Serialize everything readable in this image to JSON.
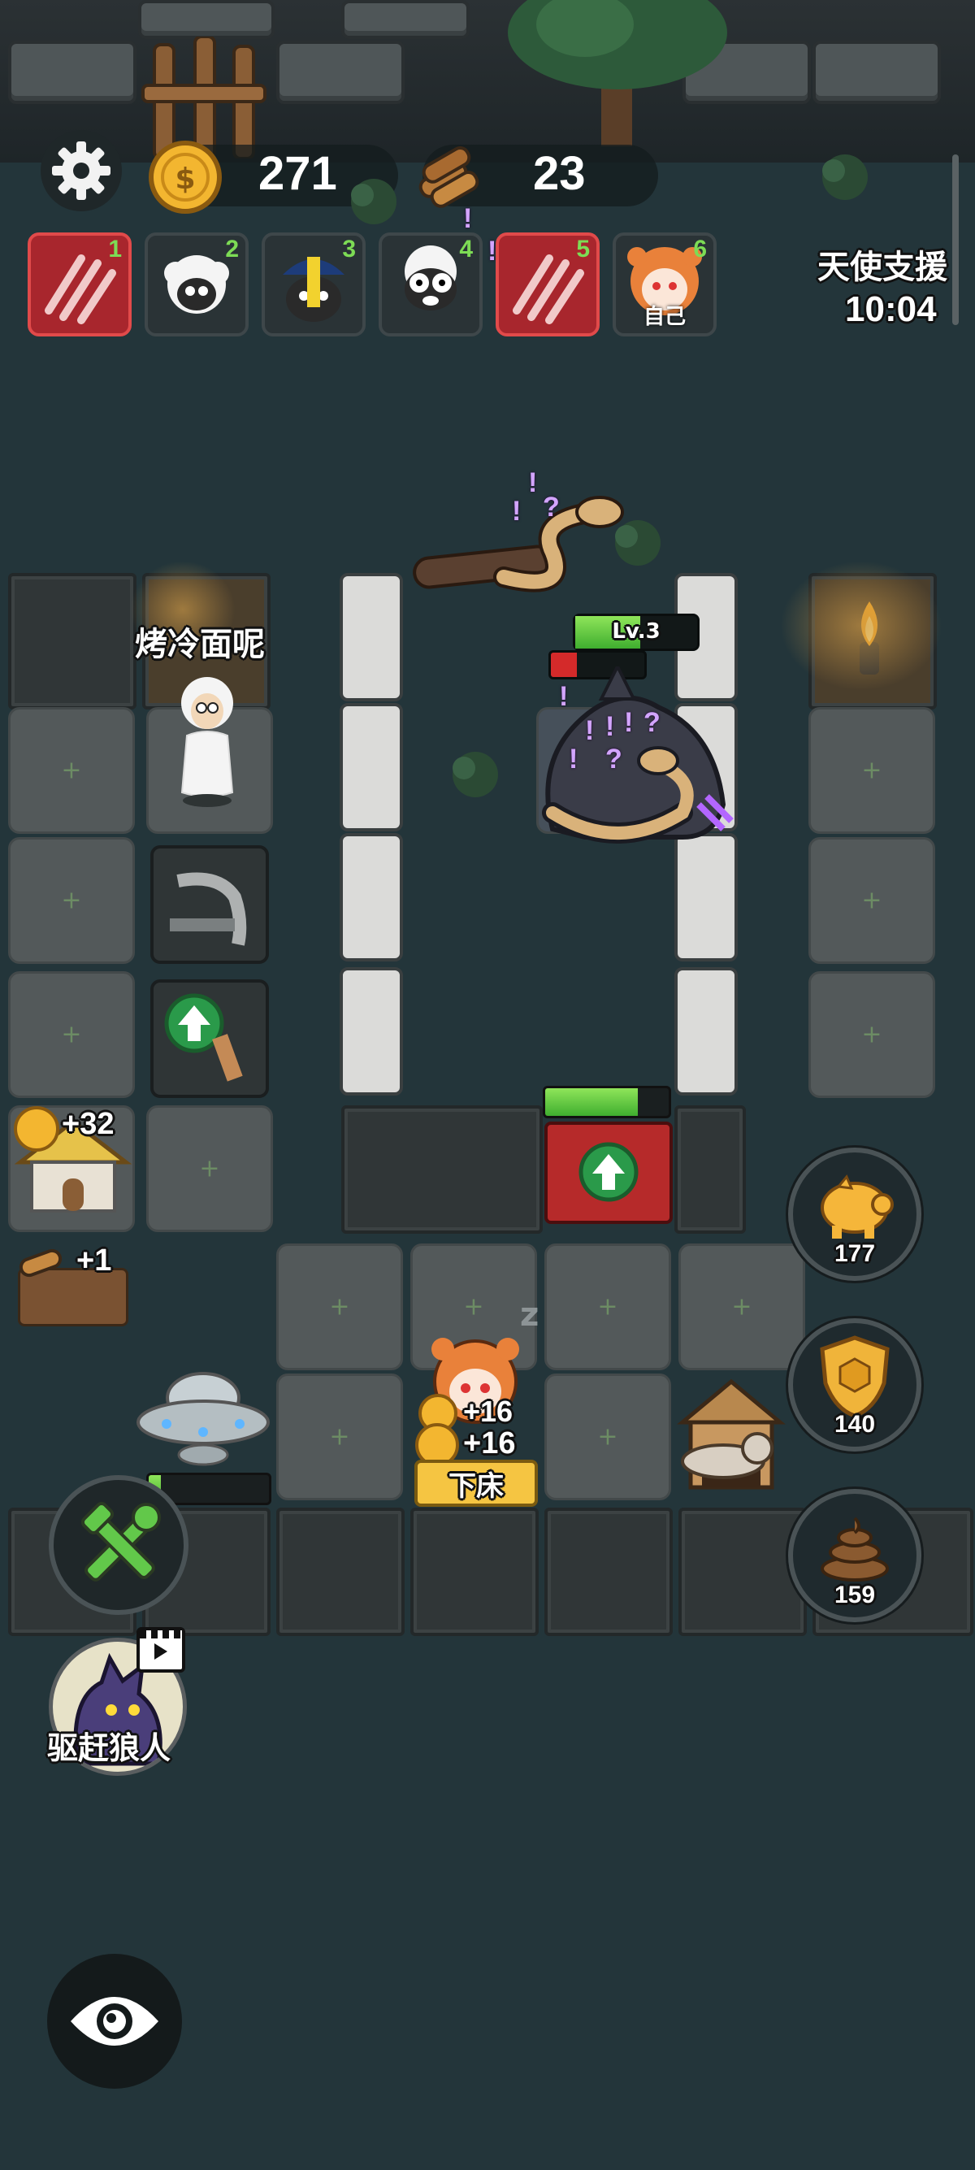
{
  "hud": {
    "coins": "271",
    "wood": "23",
    "event_title": "天使支援",
    "event_timer": "10:04"
  },
  "team": [
    {
      "num": "1",
      "type": "claw",
      "label": ""
    },
    {
      "num": "2",
      "type": "sheep",
      "label": ""
    },
    {
      "num": "3",
      "type": "sheep-hat",
      "label": ""
    },
    {
      "num": "4",
      "type": "sheep-shocked",
      "label": ""
    },
    {
      "num": "5",
      "type": "claw",
      "label": ""
    },
    {
      "num": "6",
      "type": "tiger-sheep",
      "label": "自己"
    }
  ],
  "player": {
    "name": "烤冷面呢"
  },
  "enemy": {
    "level": "Lv.3",
    "health_fraction": 0.28
  },
  "door": {
    "health_fraction": 0.75
  },
  "buildings": {
    "hut_income": "+32",
    "woodpile_income": "+1",
    "ufo_progress_fraction": 0.1
  },
  "bed": {
    "income_1": "+16",
    "income_2": "+16",
    "action_label": "下床"
  },
  "side_buttons": [
    {
      "name": "piggy-bank",
      "count": "177"
    },
    {
      "name": "shield",
      "count": "140"
    },
    {
      "name": "poop",
      "count": "159"
    }
  ],
  "wolf_button": {
    "label": "驱赶狼人"
  },
  "colors": {
    "accent_green": "#7ddc55",
    "alert_red": "#d42a2a",
    "coin_gold": "#f3b630",
    "magic_purple": "#d3a5ff"
  }
}
